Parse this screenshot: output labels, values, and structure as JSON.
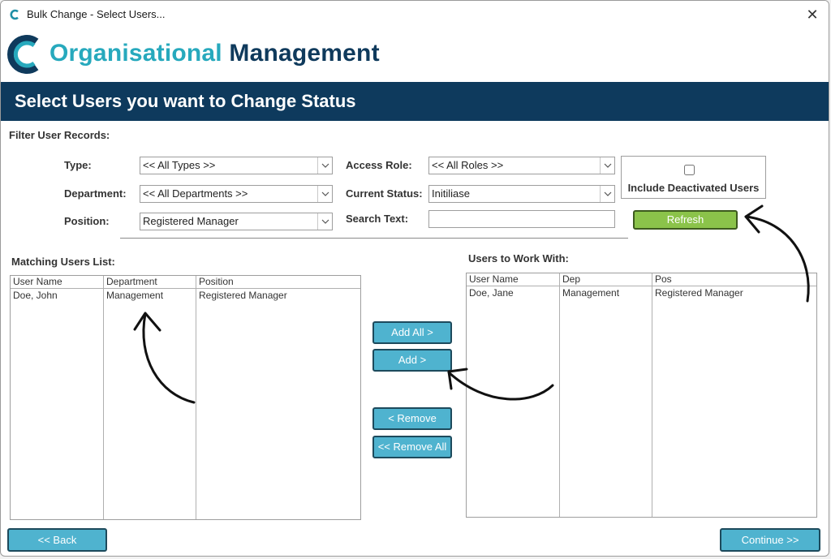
{
  "window": {
    "title": "Bulk Change - Select Users...",
    "close_symbol": "✕"
  },
  "brand": {
    "name_part1": "Organisational",
    "name_part2": "Management"
  },
  "banner": {
    "title": "Select Users you want to Change Status"
  },
  "filter": {
    "heading": "Filter User Records:",
    "type": {
      "label": "Type:",
      "value": "<< All Types >>"
    },
    "department": {
      "label": "Department:",
      "value": "<< All Departments >>"
    },
    "position": {
      "label": "Position:",
      "value": "Registered Manager"
    },
    "access_role": {
      "label": "Access Role:",
      "value": "<< All Roles >>"
    },
    "current_status": {
      "label": "Current Status:",
      "value": "Initiliase"
    },
    "search_text": {
      "label": "Search Text:",
      "value": ""
    },
    "include_deactivated": {
      "label": "Include Deactivated Users",
      "checked": false
    },
    "refresh_label": "Refresh"
  },
  "matching_list": {
    "heading": "Matching Users List:",
    "columns": [
      "User Name",
      "Department",
      "Position"
    ],
    "rows": [
      [
        "Doe, John",
        "Management",
        "Registered Manager"
      ]
    ]
  },
  "work_list": {
    "heading": "Users to Work With:",
    "columns": [
      "User Name",
      "Dep",
      "Pos"
    ],
    "rows": [
      [
        "Doe, Jane",
        "Management",
        "Registered Manager"
      ]
    ]
  },
  "actions": {
    "add_all": "Add  All >",
    "add": "Add >",
    "remove": "< Remove",
    "remove_all": "<< Remove All"
  },
  "nav": {
    "back": "<< Back",
    "continue": "Continue >>"
  },
  "colors": {
    "brand_teal": "#27a9bd",
    "brand_navy": "#0e3a5d",
    "button_blue": "#4fb3cf",
    "refresh_green": "#8bc34a"
  }
}
